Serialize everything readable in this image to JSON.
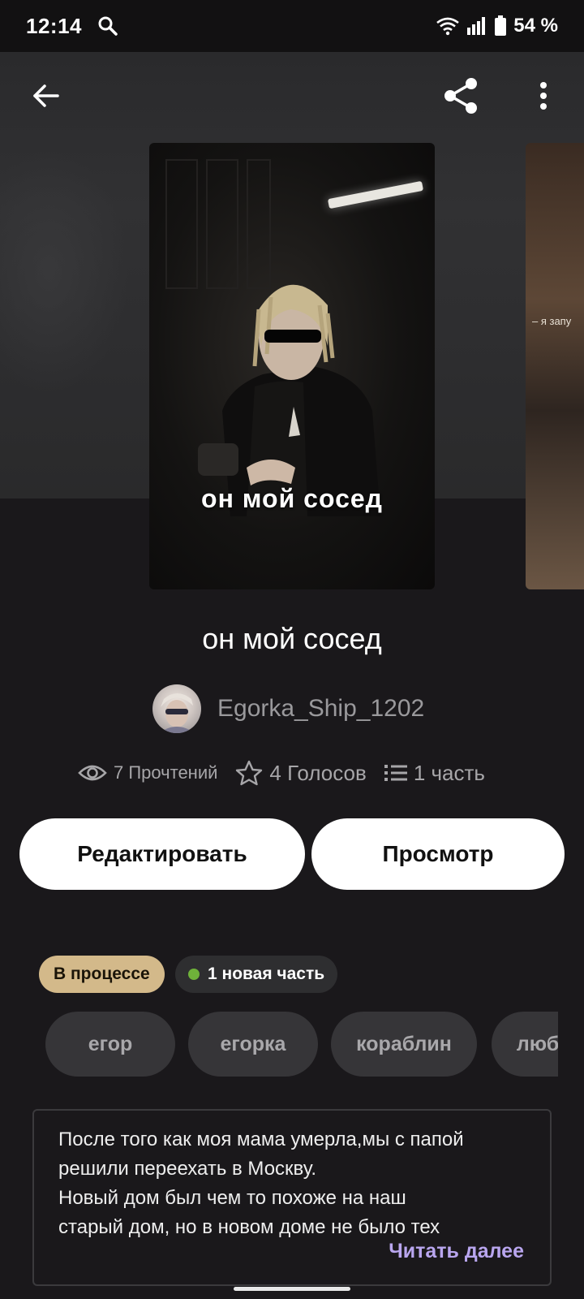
{
  "status_bar": {
    "time": "12:14",
    "battery": "54 %"
  },
  "header": {
    "back_icon": "arrow-left-icon",
    "share_icon": "share-icon",
    "more_icon": "more-vertical-icon"
  },
  "cover": {
    "title": "он мой сосед",
    "next_cover_text": "– я запу"
  },
  "story": {
    "title": "он мой сосед",
    "author": "Egorka_Ship_1202"
  },
  "stats": {
    "reads": "7 Прочтений",
    "votes": "4 Голосов",
    "parts": "1 часть"
  },
  "actions": {
    "edit": "Редактировать",
    "view": "Просмотр"
  },
  "badges": {
    "status": "В процессе",
    "new_part": "1 новая часть"
  },
  "tags": [
    "егор",
    "егорка",
    "кораблин",
    "любовь"
  ],
  "description": {
    "lines": [
      "После того как моя мама умерла,мы с папой",
      "решили переехать в Москву.",
      "Новый дом был чем то похоже на наш",
      "старый дом, но в новом доме не было тех"
    ],
    "read_more": "Читать далее"
  },
  "colors": {
    "background": "#1a181b",
    "status_badge": "#d3b98a",
    "new_dot": "#6fb23a",
    "read_more": "#b9a6ef"
  }
}
